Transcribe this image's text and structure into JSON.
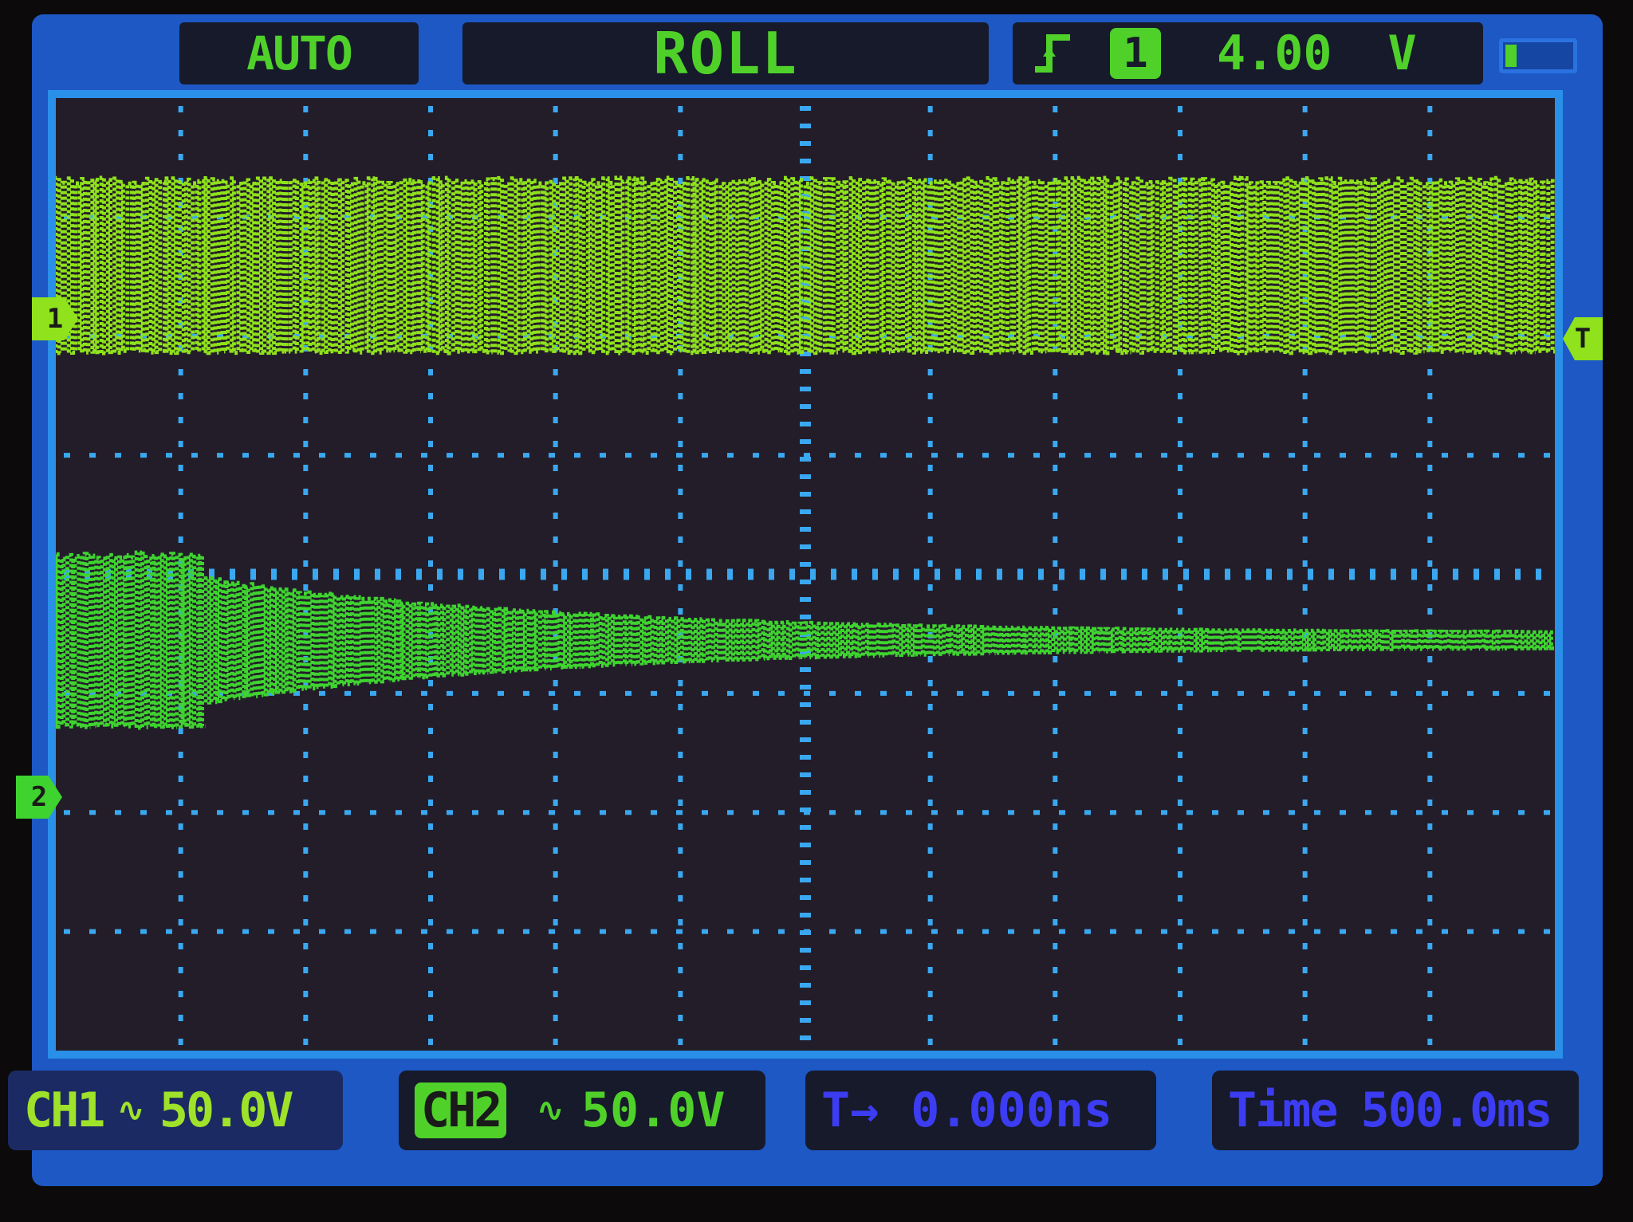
{
  "header": {
    "trigger_mode": "AUTO",
    "acquisition_mode": "ROLL",
    "trigger_source": "1",
    "trigger_level": "4.00",
    "trigger_unit": "V",
    "icons": [
      "trigger-rising-edge-icon",
      "battery-icon"
    ]
  },
  "markers": {
    "ch1": "1",
    "ch2": "2",
    "trigger_level": "T"
  },
  "footer": {
    "ch1_label": "CH1",
    "ch1_coupling": "∿",
    "ch1_scale": "50.0V",
    "ch2_label": "CH2",
    "ch2_coupling": "∿",
    "ch2_scale": "50.0V",
    "trigger_pos_label": "T→",
    "trigger_pos_value": "0.000ns",
    "timebase_label": "Time",
    "timebase_value": "500.0ms"
  },
  "colors": {
    "ch1": "#8fe21c",
    "ch2": "#3fd330",
    "grid": "#3aa8f0",
    "frame": "#2a8fe8",
    "text_blue": "#3c3cf2"
  },
  "waveforms": {
    "ch1": {
      "description": "dense square pulse train",
      "amplitude_fraction": 1.0,
      "decay": false
    },
    "ch2": {
      "description": "decaying pulse train",
      "amplitude_fraction_start": 1.0,
      "amplitude_fraction_end": 0.08,
      "decay": true
    }
  }
}
